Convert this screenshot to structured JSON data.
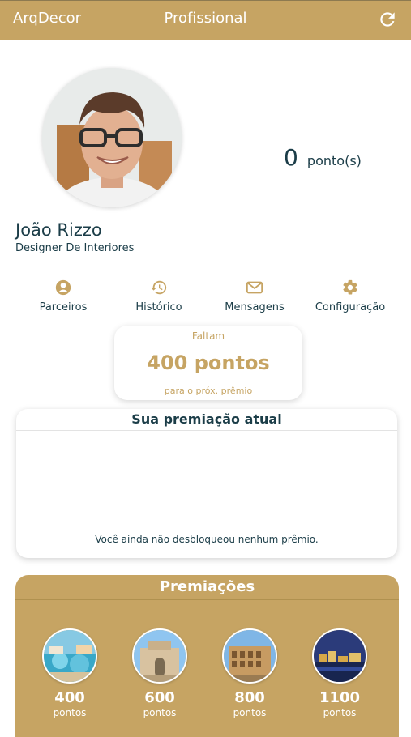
{
  "header": {
    "brand": "ArqDecor",
    "title": "Profissional",
    "refresh_icon": "refresh-icon"
  },
  "profile": {
    "name": "João Rizzo",
    "role": "Designer De Interiores",
    "points_value": "0",
    "points_unit": "ponto(s)"
  },
  "menu": [
    {
      "label": "Parceiros",
      "icon": "user-circle-icon"
    },
    {
      "label": "Histórico",
      "icon": "history-icon"
    },
    {
      "label": "Mensagens",
      "icon": "mail-icon"
    },
    {
      "label": "Configuração",
      "icon": "gear-icon"
    }
  ],
  "next_prize": {
    "top": "Faltam",
    "value": "400 pontos",
    "bottom": "para o próx. prêmio"
  },
  "current_award": {
    "title": "Sua premiação atual",
    "empty_message": "Você ainda não desbloqueou nenhum prêmio."
  },
  "prizes": {
    "title": "Premiações",
    "items": [
      {
        "value": "400",
        "unit": "pontos"
      },
      {
        "value": "600",
        "unit": "pontos"
      },
      {
        "value": "800",
        "unit": "pontos"
      },
      {
        "value": "1100",
        "unit": "pontos"
      }
    ]
  },
  "colors": {
    "gold": "#c6a463",
    "navy": "#1b3d48",
    "white": "#ffffff"
  }
}
